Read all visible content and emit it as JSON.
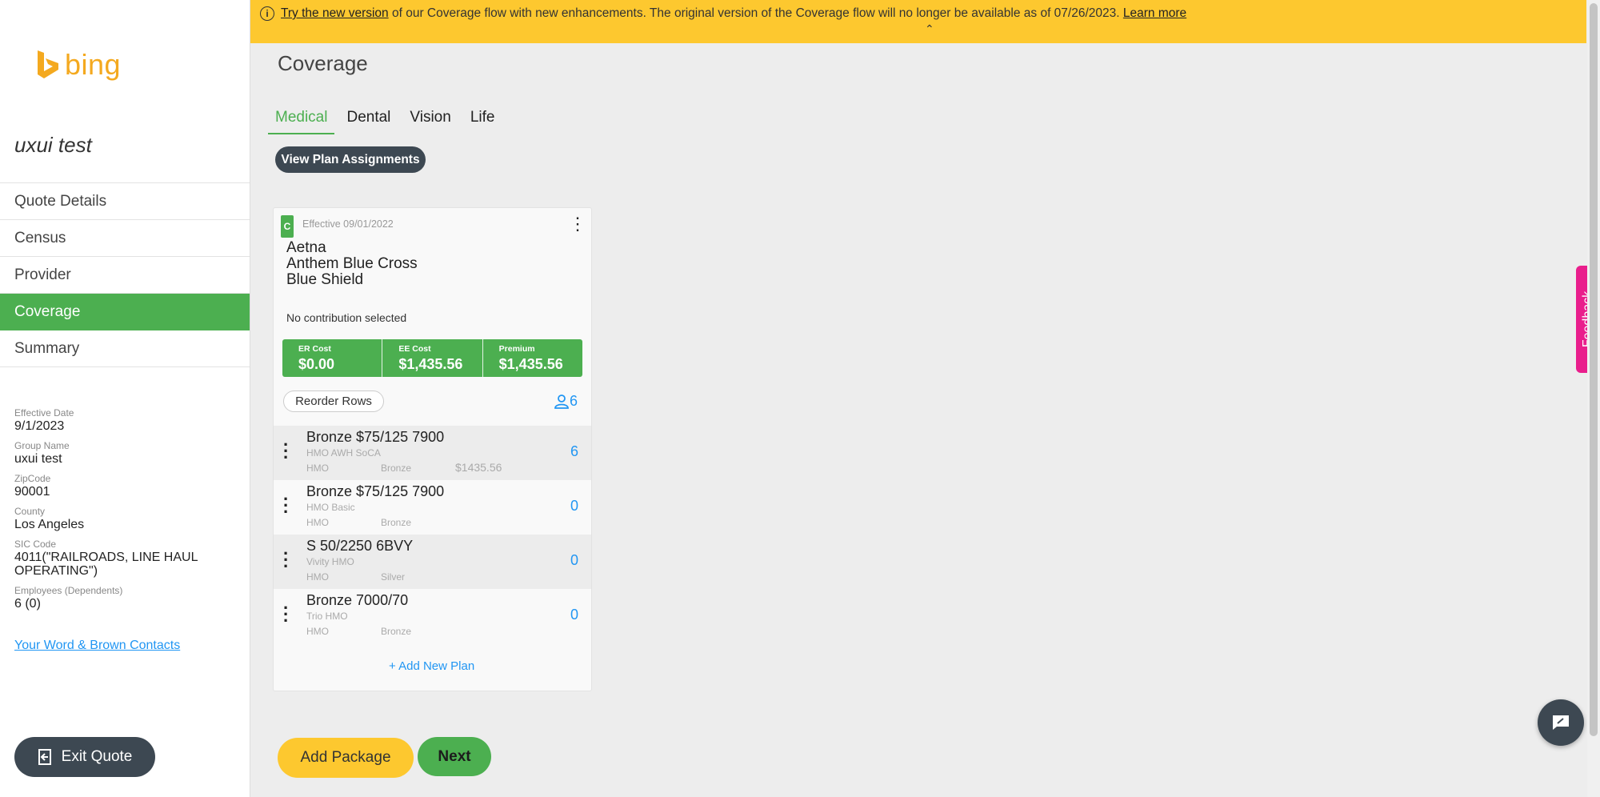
{
  "brand": {
    "name": "bing",
    "color": "#f4a91f"
  },
  "sidebar": {
    "group_title": "uxui test",
    "nav": [
      {
        "label": "Quote Details",
        "active": false
      },
      {
        "label": "Census",
        "active": false
      },
      {
        "label": "Provider",
        "active": false
      },
      {
        "label": "Coverage",
        "active": true
      },
      {
        "label": "Summary",
        "active": false
      }
    ],
    "details": [
      {
        "label": "Effective Date",
        "value": "9/1/2023"
      },
      {
        "label": "Group Name",
        "value": "uxui test"
      },
      {
        "label": "ZipCode",
        "value": "90001"
      },
      {
        "label": "County",
        "value": "Los Angeles"
      },
      {
        "label": "SIC Code",
        "value": "4011(\"RAILROADS, LINE HAUL OPERATING\")"
      },
      {
        "label": "Employees (Dependents)",
        "value": "6 (0)"
      }
    ],
    "contacts_link": "Your Word & Brown Contacts",
    "exit_label": "Exit Quote"
  },
  "banner": {
    "link_try": "Try the new version",
    "text": " of our Coverage flow with new enhancements. The original version of the Coverage flow will no longer be available as of 07/26/2023. ",
    "link_learn": "Learn more",
    "caret": "⌃"
  },
  "main": {
    "title": "Coverage",
    "tabs": [
      {
        "label": "Medical",
        "active": true
      },
      {
        "label": "Dental",
        "active": false
      },
      {
        "label": "Vision",
        "active": false
      },
      {
        "label": "Life",
        "active": false
      }
    ],
    "view_assignments_label": "View Plan Assignments"
  },
  "card": {
    "badge": "C",
    "effective": "Effective 09/01/2022",
    "carrier_name": "Aetna\nAnthem Blue Cross\nBlue Shield",
    "contribution": "No contribution selected",
    "costs": [
      {
        "label": "ER Cost",
        "value": "$0.00"
      },
      {
        "label": "EE Cost",
        "value": "$1,435.56"
      },
      {
        "label": "Premium",
        "value": "$1,435.56"
      }
    ],
    "reorder_label": "Reorder Rows",
    "employee_count": "6",
    "plans": [
      {
        "name": "Bronze $75/125 7900",
        "sub": "HMO AWH SoCA",
        "type": "HMO",
        "tier": "Bronze",
        "price": "$1435.56",
        "count": "6"
      },
      {
        "name": "Bronze $75/125 7900",
        "sub": "HMO Basic",
        "type": "HMO",
        "tier": "Bronze",
        "price": "",
        "count": "0"
      },
      {
        "name": "S 50/2250 6BVY",
        "sub": "Vivity HMO",
        "type": "HMO",
        "tier": "Silver",
        "price": "",
        "count": "0"
      },
      {
        "name": "Bronze 7000/70",
        "sub": "Trio HMO",
        "type": "HMO",
        "tier": "Bronze",
        "price": "",
        "count": "0"
      }
    ],
    "add_plan_label": "Add New Plan"
  },
  "actions": {
    "add_package_label": "Add Package",
    "next_label": "Next"
  },
  "feedback_label": "Feedback",
  "colors": {
    "accent_green": "#4caf50",
    "banner_yellow": "#fdc82f",
    "dark": "#3d4852",
    "link_blue": "#2196f3",
    "feedback_pink": "#e91e8c"
  }
}
